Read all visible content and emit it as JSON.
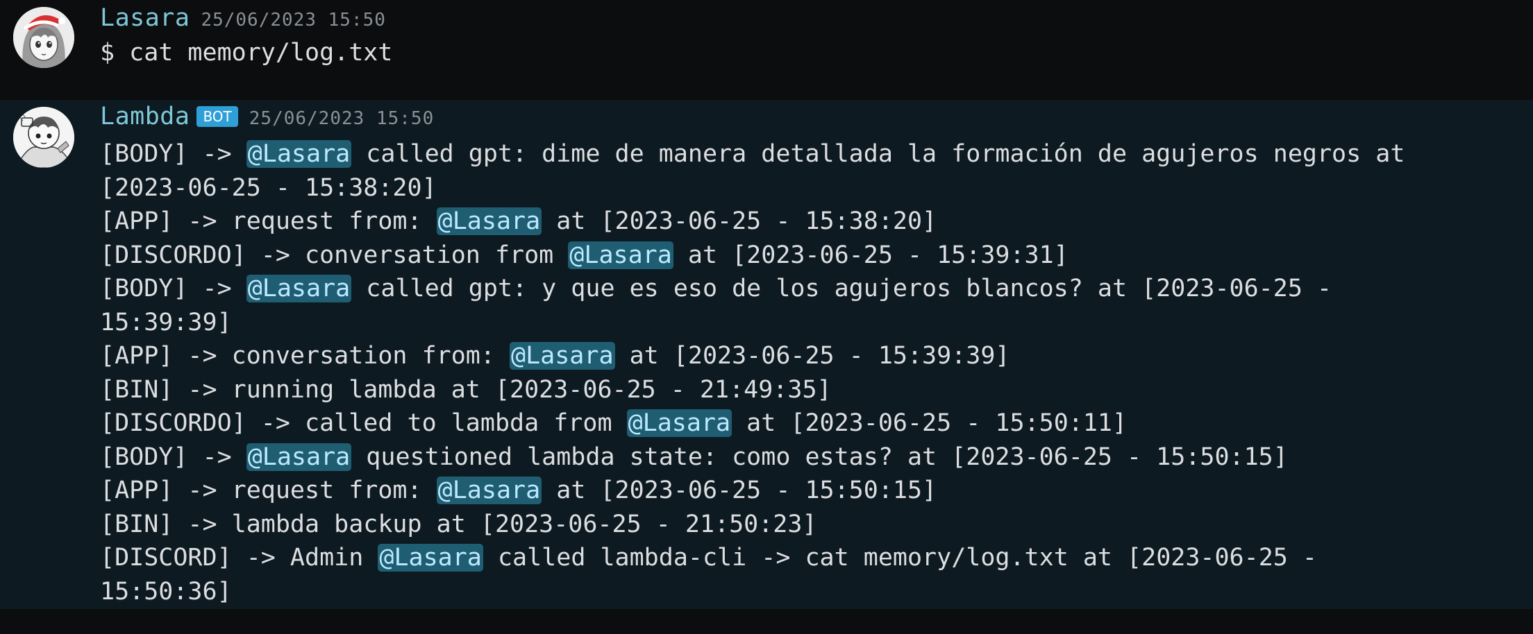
{
  "messages": [
    {
      "author": "Lasara",
      "timestamp": "25/06/2023 15:50",
      "content": "$ cat memory/log.txt"
    },
    {
      "author": "Lambda",
      "badge": "BOT",
      "timestamp": "25/06/2023 15:50",
      "lines": [
        [
          {
            "t": "[BODY] -> "
          },
          {
            "m": "@Lasara"
          },
          {
            "t": " called gpt: dime de manera detallada la formación de agujeros negros at"
          }
        ],
        [
          {
            "t": "[2023-06-25 - 15:38:20]"
          }
        ],
        [
          {
            "t": "[APP] -> request from: "
          },
          {
            "m": "@Lasara"
          },
          {
            "t": " at [2023-06-25 - 15:38:20]"
          }
        ],
        [
          {
            "t": "[DISCORDO] -> conversation from "
          },
          {
            "m": "@Lasara"
          },
          {
            "t": " at [2023-06-25 - 15:39:31]"
          }
        ],
        [
          {
            "t": "[BODY] -> "
          },
          {
            "m": "@Lasara"
          },
          {
            "t": " called gpt: y que es eso de los agujeros blancos? at [2023-06-25 -"
          }
        ],
        [
          {
            "t": "15:39:39]"
          }
        ],
        [
          {
            "t": "[APP] -> conversation from: "
          },
          {
            "m": "@Lasara"
          },
          {
            "t": " at [2023-06-25 - 15:39:39]"
          }
        ],
        [
          {
            "t": "[BIN] -> running lambda at [2023-06-25 - 21:49:35]"
          }
        ],
        [
          {
            "t": "[DISCORDO] -> called to lambda from "
          },
          {
            "m": "@Lasara"
          },
          {
            "t": " at [2023-06-25 - 15:50:11]"
          }
        ],
        [
          {
            "t": "[BODY] -> "
          },
          {
            "m": "@Lasara"
          },
          {
            "t": " questioned lambda state: como estas? at [2023-06-25 - 15:50:15]"
          }
        ],
        [
          {
            "t": "[APP] -> request from: "
          },
          {
            "m": "@Lasara"
          },
          {
            "t": " at [2023-06-25 - 15:50:15]"
          }
        ],
        [
          {
            "t": "[BIN] -> lambda backup at [2023-06-25 - 21:50:23]"
          }
        ],
        [
          {
            "t": "[DISCORD] -> Admin "
          },
          {
            "m": "@Lasara"
          },
          {
            "t": " called lambda-cli -> cat memory/log.txt at [2023-06-25 -"
          }
        ],
        [
          {
            "t": "15:50:36]"
          }
        ]
      ]
    }
  ],
  "colors": {
    "background": "#0c0d0e",
    "highlight_background": "#0e1a21",
    "username": "#7ec8d8",
    "bot_badge": "#2f9fd8",
    "mention_background": "#1f5e72",
    "mention_text": "#bde9ff"
  },
  "icons": {
    "author1_avatar": "anime-girl-santa-hat-avatar",
    "author2_avatar": "manga-character-avatar"
  }
}
